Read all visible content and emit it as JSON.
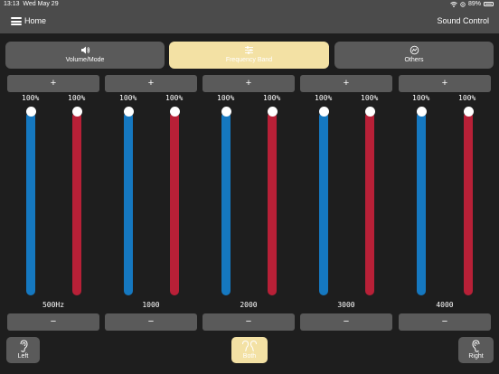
{
  "status_bar": {
    "time": "13:13",
    "date": "Wed May 29",
    "battery": "89%",
    "wifi_icon": "wifi-icon",
    "location_icon": "location-icon",
    "battery_icon": "battery-icon"
  },
  "nav": {
    "home_label": "Home",
    "title": "Sound Control",
    "menu_icon": "hamburger-icon"
  },
  "tabs": [
    {
      "label": "Volume/Mode",
      "icon": "speaker-icon",
      "active": false
    },
    {
      "label": "Frequency Band",
      "icon": "sliders-icon",
      "active": true
    },
    {
      "label": "Others",
      "icon": "gauge-icon",
      "active": false
    }
  ],
  "bands": [
    {
      "frequency": "500Hz",
      "left_percent": "100%",
      "right_percent": "100%",
      "left_level": 1.0,
      "right_level": 1.0,
      "plus_label": "+",
      "minus_label": "−"
    },
    {
      "frequency": "1000",
      "left_percent": "100%",
      "right_percent": "100%",
      "left_level": 1.0,
      "right_level": 1.0,
      "plus_label": "+",
      "minus_label": "−"
    },
    {
      "frequency": "2000",
      "left_percent": "100%",
      "right_percent": "100%",
      "left_level": 1.0,
      "right_level": 1.0,
      "plus_label": "+",
      "minus_label": "−"
    },
    {
      "frequency": "3000",
      "left_percent": "100%",
      "right_percent": "100%",
      "left_level": 1.0,
      "right_level": 1.0,
      "plus_label": "+",
      "minus_label": "−"
    },
    {
      "frequency": "4000",
      "left_percent": "100%",
      "right_percent": "100%",
      "left_level": 1.0,
      "right_level": 1.0,
      "plus_label": "+",
      "minus_label": "−"
    }
  ],
  "ear_selector": {
    "left_label": "Left",
    "both_label": "Both",
    "right_label": "Right",
    "selected": "Both"
  },
  "colors": {
    "left_channel": "#1578c0",
    "right_channel": "#b82037",
    "active_tab": "#f3e1a4",
    "button": "#5a5a5a"
  }
}
